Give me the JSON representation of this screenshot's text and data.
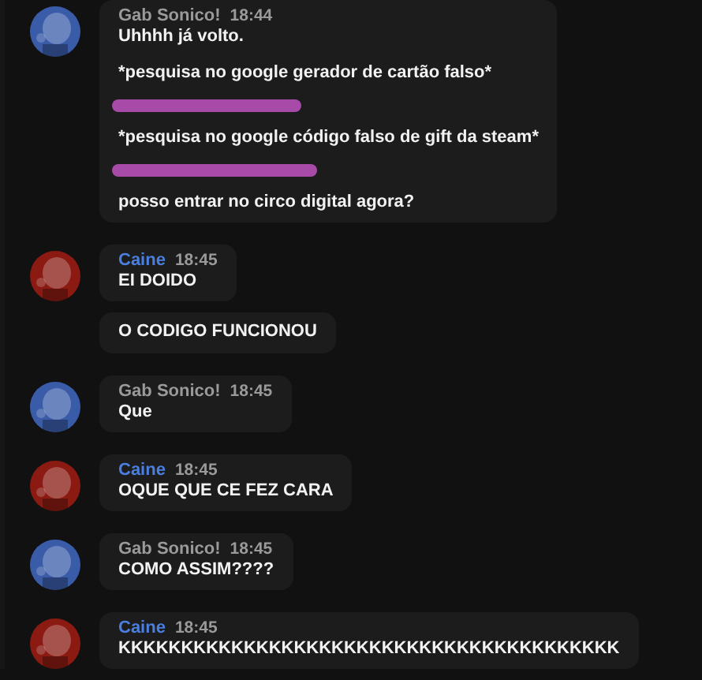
{
  "messages": [
    {
      "author": "Gab Sonico!",
      "color": "#9a9a9a",
      "avatar": {
        "kind": "picture",
        "color": "#3a5ca8"
      },
      "time": "18:44",
      "bubbles": [
        [
          {
            "kind": "text",
            "text": "Uhhhh já volto."
          },
          {
            "kind": "text",
            "text": "*pesquisa no google gerador de cartão falso*"
          },
          {
            "kind": "redaction"
          },
          {
            "kind": "text",
            "text": "*pesquisa no google código falso de gift da steam*"
          },
          {
            "kind": "redaction"
          },
          {
            "kind": "text",
            "text": "posso entrar no circo digital agora?"
          }
        ]
      ]
    },
    {
      "author": "Caine",
      "color": "#4a7fe0",
      "avatar": {
        "kind": "picture",
        "color": "#8a1a12"
      },
      "time": "18:45",
      "bubbles": [
        [
          {
            "kind": "text",
            "text": "EI DOIDO"
          }
        ],
        [
          {
            "kind": "text",
            "text": "O CODIGO FUNCIONOU"
          }
        ]
      ]
    },
    {
      "author": "Gab Sonico!",
      "color": "#9a9a9a",
      "avatar": {
        "kind": "picture",
        "color": "#3a5ca8"
      },
      "time": "18:45",
      "bubbles": [
        [
          {
            "kind": "text",
            "text": "Que"
          }
        ]
      ]
    },
    {
      "author": "Caine",
      "color": "#4a7fe0",
      "avatar": {
        "kind": "picture",
        "color": "#8a1a12"
      },
      "time": "18:45",
      "bubbles": [
        [
          {
            "kind": "text",
            "text": "OQUE QUE CE FEZ CARA"
          }
        ]
      ]
    },
    {
      "author": "Gab Sonico!",
      "color": "#9a9a9a",
      "avatar": {
        "kind": "picture",
        "color": "#3a5ca8"
      },
      "time": "18:45",
      "bubbles": [
        [
          {
            "kind": "text",
            "text": "COMO ASSIM????"
          }
        ]
      ]
    },
    {
      "author": "Caine",
      "color": "#4a7fe0",
      "avatar": {
        "kind": "picture",
        "color": "#8a1a12"
      },
      "time": "18:45",
      "bubbles": [
        [
          {
            "kind": "text",
            "text": "KKKKKKKKKKKKKKKKKKKKKKKKKKKKKKKKKKKKKKKK"
          }
        ]
      ]
    }
  ]
}
